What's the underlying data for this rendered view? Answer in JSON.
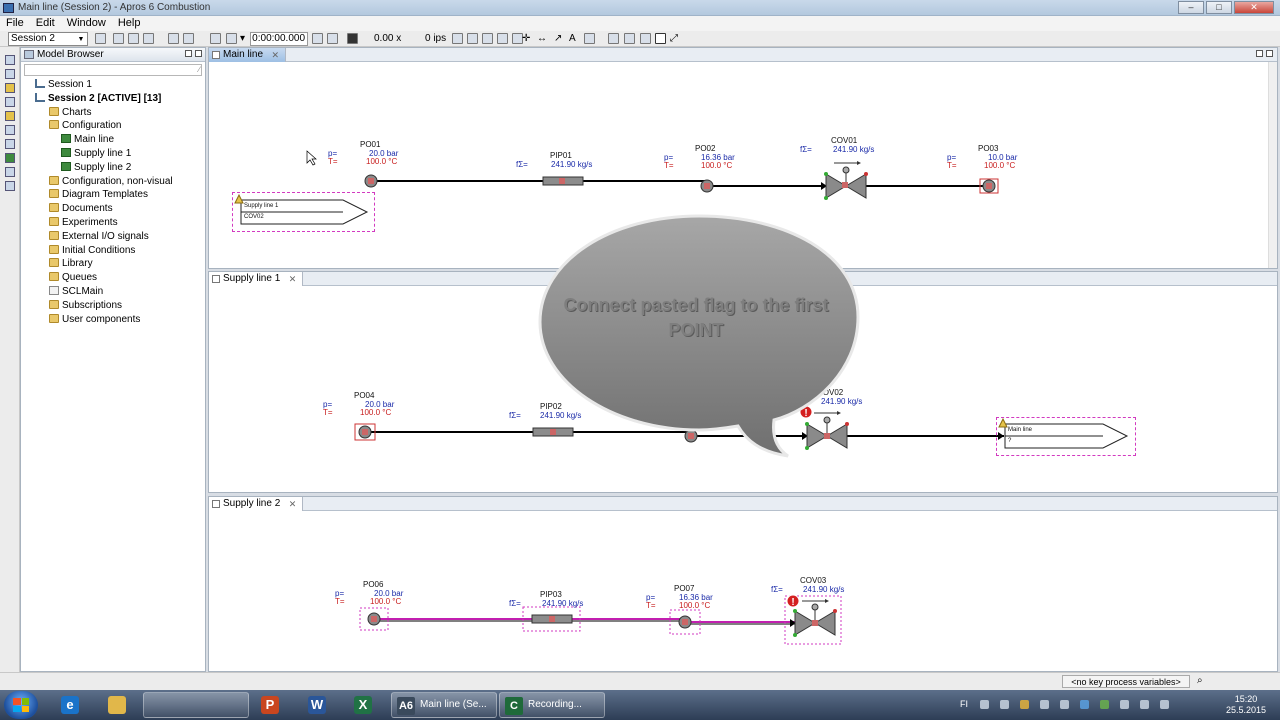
{
  "window": {
    "title": "Main line (Session 2) - Apros 6 Combustion"
  },
  "menu": [
    "File",
    "Edit",
    "Window",
    "Help"
  ],
  "toolbar": {
    "session": "Session 2",
    "time": "0:00:00.000",
    "speed": "0.00 x",
    "ips": "0 ips"
  },
  "browser": {
    "title": "Model Browser",
    "items": [
      {
        "label": "Session 1",
        "icon": "session",
        "bold": false,
        "level": 1
      },
      {
        "label": "Session 2 [ACTIVE] [13]",
        "icon": "session",
        "bold": true,
        "level": 1
      },
      {
        "label": "Charts",
        "icon": "folder",
        "bold": false,
        "level": 2
      },
      {
        "label": "Configuration",
        "icon": "folder",
        "bold": false,
        "level": 2
      },
      {
        "label": "Main line",
        "icon": "diagram",
        "bold": false,
        "level": 3
      },
      {
        "label": "Supply line 1",
        "icon": "diagram",
        "bold": false,
        "level": 3
      },
      {
        "label": "Supply line 2",
        "icon": "diagram",
        "bold": false,
        "level": 3
      },
      {
        "label": "Configuration, non-visual",
        "icon": "folder",
        "bold": false,
        "level": 2
      },
      {
        "label": "Diagram Templates",
        "icon": "folder",
        "bold": false,
        "level": 2
      },
      {
        "label": "Documents",
        "icon": "folder",
        "bold": false,
        "level": 2
      },
      {
        "label": "Experiments",
        "icon": "folder",
        "bold": false,
        "level": 2
      },
      {
        "label": "External I/O signals",
        "icon": "folder",
        "bold": false,
        "level": 2
      },
      {
        "label": "Initial Conditions",
        "icon": "folder",
        "bold": false,
        "level": 2
      },
      {
        "label": "Library",
        "icon": "folder",
        "bold": false,
        "level": 2
      },
      {
        "label": "Queues",
        "icon": "folder",
        "bold": false,
        "level": 2
      },
      {
        "label": "SCLMain",
        "icon": "page",
        "bold": false,
        "level": 2
      },
      {
        "label": "Subscriptions",
        "icon": "folder",
        "bold": false,
        "level": 2
      },
      {
        "label": "User components",
        "icon": "folder",
        "bold": false,
        "level": 2
      }
    ]
  },
  "tabs": {
    "main": "Main line",
    "supply1": "Supply line 1",
    "supply2": "Supply line 2"
  },
  "labels": {
    "p": "p=",
    "t": "T=",
    "f": "fΣ="
  },
  "main_line": {
    "po01": {
      "name": "PO01",
      "p": "20.0 bar",
      "t": "100.0 °C"
    },
    "pip01": {
      "name": "PIP01",
      "f": "241.90 kg/s"
    },
    "po02": {
      "name": "PO02",
      "p": "16.36 bar",
      "t": "100.0 °C"
    },
    "cov01": {
      "name": "COV01",
      "f": "241.90 kg/s"
    },
    "po03": {
      "name": "PO03",
      "p": "10.0 bar",
      "t": "100.0 °C"
    },
    "flag": {
      "line1": "Supply line 1",
      "line2": "COV02"
    }
  },
  "supply_line_1": {
    "po04": {
      "name": "PO04",
      "p": "20.0 bar",
      "t": "100.0 °C"
    },
    "pip02": {
      "name": "PIP02",
      "f": "241.90 kg/s"
    },
    "cov02": {
      "name": "COV02",
      "f": "241.90 kg/s"
    },
    "flag": {
      "line1": "Main line",
      "line2": "?"
    }
  },
  "supply_line_2": {
    "po06": {
      "name": "PO06",
      "p": "20.0 bar",
      "t": "100.0 °C"
    },
    "pip03": {
      "name": "PIP03",
      "f": "241.90 kg/s"
    },
    "po07": {
      "name": "PO07",
      "p": "16.36 bar",
      "t": "100.0 °C"
    },
    "cov03": {
      "name": "COV03",
      "f": "241.90 kg/s"
    }
  },
  "callout": {
    "text": "Connect pasted flag to the first POINT"
  },
  "status": {
    "kpv": "<no key process variables>"
  },
  "taskbar": {
    "win1": "Main line (Se...",
    "win2": "Recording...",
    "tray_lang": "FI",
    "time": "15:20",
    "date": "25.5.2015"
  },
  "colors": {
    "pipe_selected": "#c21fb0",
    "value_blue": "#1a2aa8",
    "value_red": "#c81e1e",
    "flag_outline": "#d23ac0"
  }
}
